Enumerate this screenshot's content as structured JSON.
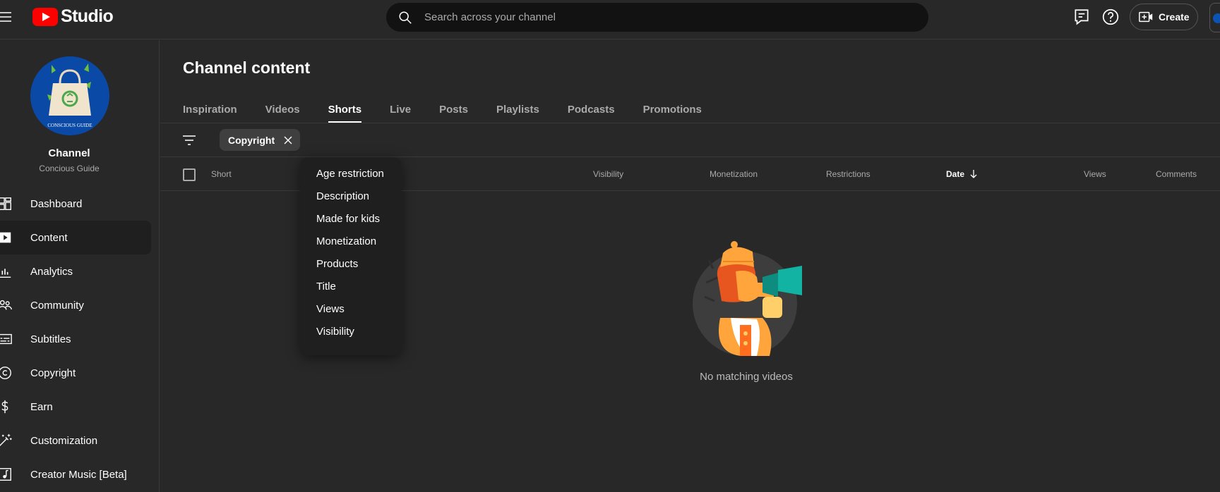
{
  "header": {
    "logo_text": "Studio",
    "search_placeholder": "Search across your channel",
    "create_label": "Create"
  },
  "sidebar": {
    "channel_label": "Channel",
    "channel_name": "Concious Guide",
    "avatar_text": "CONSCIOUS GUIDE",
    "items": [
      {
        "label": "Dashboard",
        "icon": "dashboard-icon"
      },
      {
        "label": "Content",
        "icon": "content-icon",
        "active": true
      },
      {
        "label": "Analytics",
        "icon": "analytics-icon"
      },
      {
        "label": "Community",
        "icon": "community-icon"
      },
      {
        "label": "Subtitles",
        "icon": "subtitles-icon"
      },
      {
        "label": "Copyright",
        "icon": "copyright-icon"
      },
      {
        "label": "Earn",
        "icon": "earn-icon"
      },
      {
        "label": "Customization",
        "icon": "customization-icon"
      },
      {
        "label": "Creator Music [Beta]",
        "icon": "music-icon"
      }
    ]
  },
  "main": {
    "title": "Channel content",
    "tabs": [
      "Inspiration",
      "Videos",
      "Shorts",
      "Live",
      "Posts",
      "Playlists",
      "Podcasts",
      "Promotions"
    ],
    "active_tab": "Shorts",
    "filter_chip": "Copyright",
    "columns": {
      "short": "Short",
      "visibility": "Visibility",
      "monetization": "Monetization",
      "restrictions": "Restrictions",
      "date": "Date",
      "views": "Views",
      "comments": "Comments"
    },
    "empty_text": "No matching videos"
  },
  "dropdown": {
    "items": [
      "Age restriction",
      "Description",
      "Made for kids",
      "Monetization",
      "Products",
      "Title",
      "Views",
      "Visibility"
    ]
  },
  "colors": {
    "background": "#282828",
    "brand_red": "#ff0000",
    "dropdown_bg": "#1f1f1f",
    "chip_bg": "#3f3f3f"
  }
}
